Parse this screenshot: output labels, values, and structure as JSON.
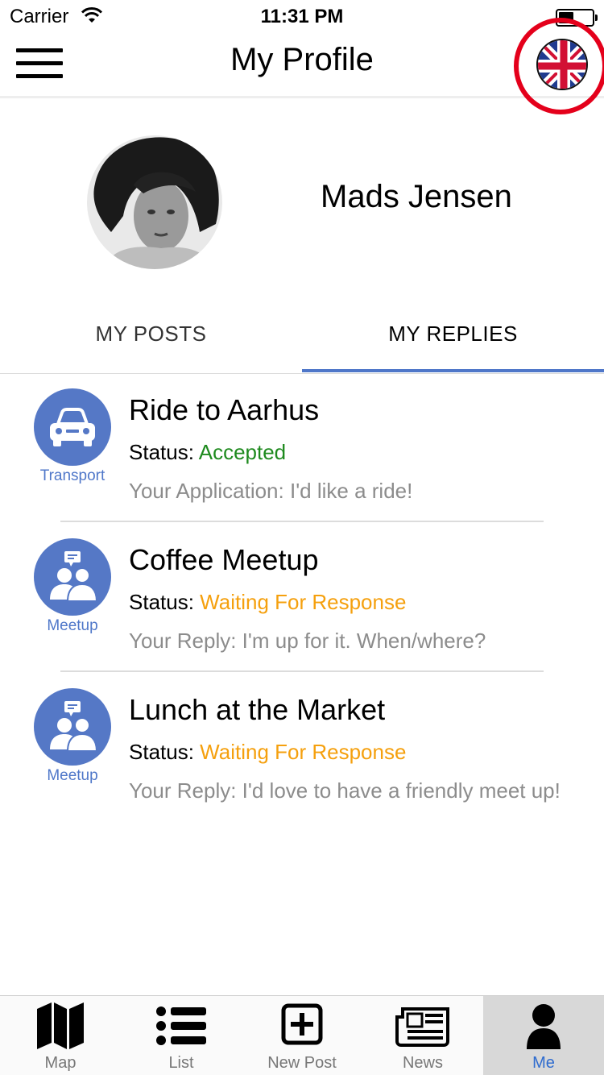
{
  "status_bar": {
    "carrier": "Carrier",
    "time": "11:31 PM"
  },
  "nav": {
    "title": "My Profile",
    "menu_icon": "hamburger-menu-icon",
    "language_icon": "uk-flag-icon"
  },
  "profile": {
    "name": "Mads Jensen"
  },
  "tabs": [
    {
      "label": "MY POSTS",
      "active": false
    },
    {
      "label": "MY REPLIES",
      "active": true
    }
  ],
  "replies": [
    {
      "title": "Ride to Aarhus",
      "category": "Transport",
      "category_icon": "car-icon",
      "status_label": "Status:",
      "status": "Accepted",
      "status_color": "#1e8a1e",
      "message": "Your Application: I'd like a ride!"
    },
    {
      "title": "Coffee Meetup",
      "category": "Meetup",
      "category_icon": "people-chat-icon",
      "status_label": "Status:",
      "status": "Waiting For Response",
      "status_color": "#f5a00e",
      "message": "Your Reply: I'm up for it.  When/where?"
    },
    {
      "title": "Lunch at the Market",
      "category": "Meetup",
      "category_icon": "people-chat-icon",
      "status_label": "Status:",
      "status": "Waiting For Response",
      "status_color": "#f5a00e",
      "message": "Your Reply: I'd love to have a friendly meet up!"
    }
  ],
  "tab_bar": [
    {
      "label": "Map",
      "icon": "map-icon",
      "active": false
    },
    {
      "label": "List",
      "icon": "list-icon",
      "active": false
    },
    {
      "label": "New Post",
      "icon": "new-post-icon",
      "active": false
    },
    {
      "label": "News",
      "icon": "newspaper-icon",
      "active": false
    },
    {
      "label": "Me",
      "icon": "person-icon",
      "active": true
    }
  ],
  "colors": {
    "accent": "#4f77c9",
    "highlight_ring": "#e4001b",
    "accepted": "#1e8a1e",
    "waiting": "#f5a00e"
  }
}
